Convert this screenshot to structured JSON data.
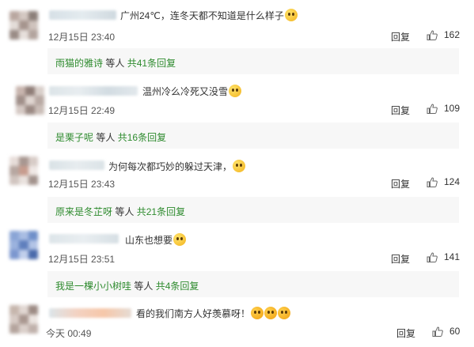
{
  "comments": [
    {
      "text": "广州24℃，连冬天都不知道是什么样子",
      "time": "12月15日 23:40",
      "reply_label": "回复",
      "likes": "162",
      "reply_preview": {
        "user": "雨猫的雅诗",
        "suffix": "等人",
        "count": "共41条回复"
      }
    },
    {
      "text": "温州冷么冷死又没雪",
      "time": "12月15日 22:49",
      "reply_label": "回复",
      "likes": "109",
      "reply_preview": {
        "user": "是栗子呢",
        "suffix": "等人",
        "count": "共16条回复"
      }
    },
    {
      "text": "为何每次都巧妙的躲过天津，",
      "time": "12月15日 23:43",
      "reply_label": "回复",
      "likes": "124",
      "reply_preview": {
        "user": "原来是冬芷呀",
        "suffix": "等人",
        "count": "共21条回复"
      }
    },
    {
      "text": "山东也想要",
      "time": "12月15日 23:51",
      "reply_label": "回复",
      "likes": "141",
      "reply_preview": {
        "user": "我是一棵小小树哇",
        "suffix": "等人",
        "count": "共4条回复"
      }
    },
    {
      "text": "看的我们南方人好羡慕呀！",
      "time": "今天 00:49",
      "reply_label": "回复",
      "likes": "60"
    }
  ],
  "icons": {
    "like": "thumbs-up-icon",
    "emoji": "emoji-icon"
  },
  "colors": {
    "reply_link": "#2e8b2e",
    "reply_box_bg": "#f7f7f7",
    "text": "#333333"
  }
}
